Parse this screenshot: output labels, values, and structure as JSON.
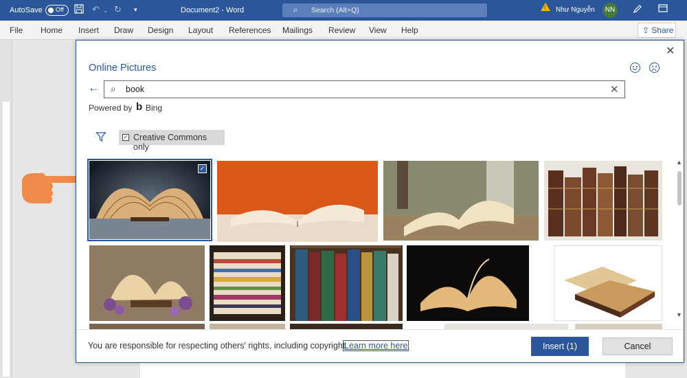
{
  "titlebar": {
    "autosave_label": "AutoSave",
    "autosave_state": "Off",
    "document_title": "Document2  -  Word",
    "search_placeholder": "Search (Alt+Q)",
    "user_name": "Như Nguyễn",
    "user_initials": "NN",
    "accent_color": "#2b579a",
    "avatar_color": "#487a3d"
  },
  "ribbon": {
    "tabs": [
      "File",
      "Home",
      "Insert",
      "Draw",
      "Design",
      "Layout",
      "References",
      "Mailings",
      "Review",
      "View",
      "Help"
    ],
    "share_label": "Share"
  },
  "dialog": {
    "title": "Online Pictures",
    "search_value": "book",
    "powered_by": "Powered by",
    "provider": "Bing",
    "filter_label": "Creative Commons only",
    "filter_checked": true,
    "images": [
      {
        "subject": "open book fanned pages on dark background",
        "selected": true
      },
      {
        "subject": "open book on orange background",
        "selected": false
      },
      {
        "subject": "open book outdoors with columns",
        "selected": false
      },
      {
        "subject": "row of old leather books",
        "selected": false
      },
      {
        "subject": "fanned book with purple flowers",
        "selected": false
      },
      {
        "subject": "stack of colorful magazines",
        "selected": false
      },
      {
        "subject": "bookshelf of Chronicles of Narnia",
        "selected": false
      },
      {
        "subject": "open book glowing on black",
        "selected": false
      },
      {
        "subject": "pile of antique open books",
        "selected": false
      }
    ],
    "notice": "You are responsible for respecting others' rights, including copyright.",
    "learn_more": "Learn more here",
    "insert_label": "Insert (1)",
    "cancel_label": "Cancel"
  },
  "pointer_hand_color": "#f08a4b"
}
